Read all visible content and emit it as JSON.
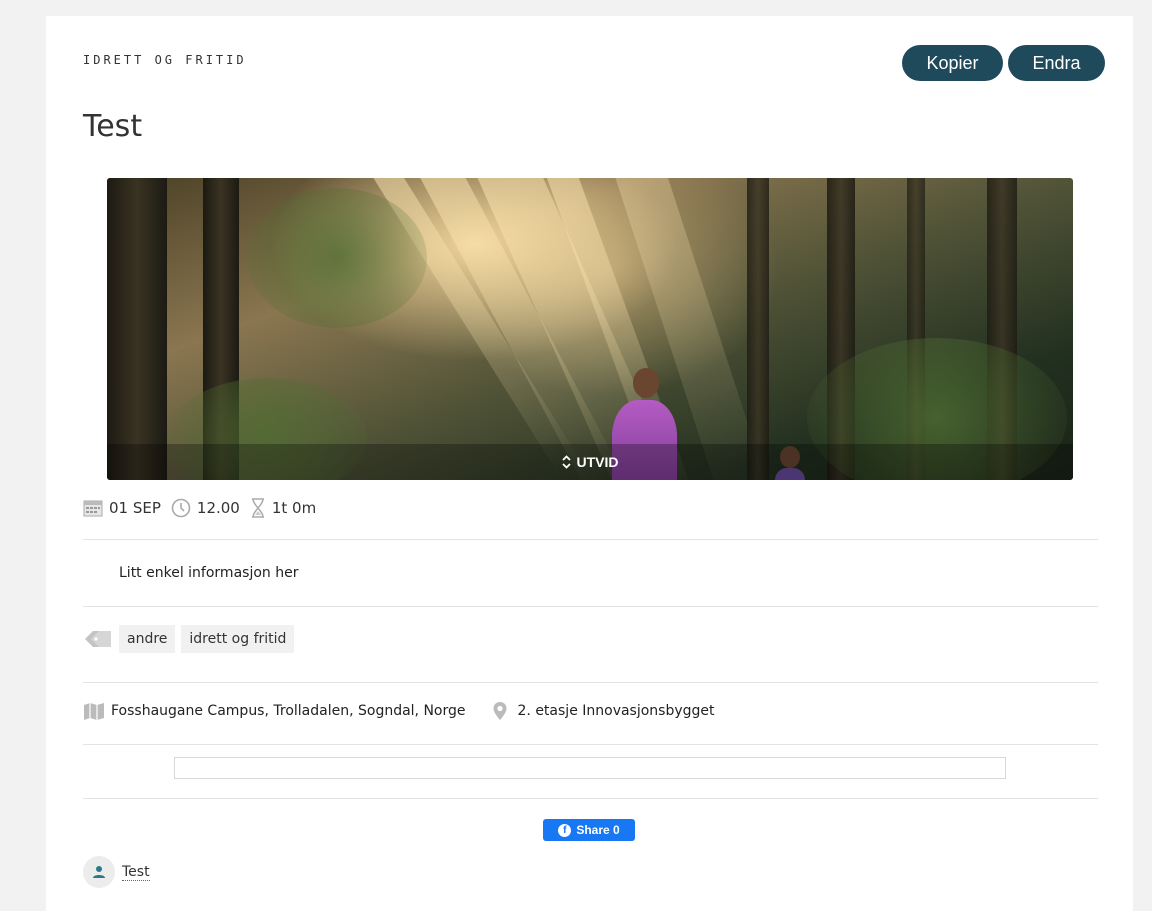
{
  "header": {
    "category": "IDRETT OG FRITID",
    "copy_label": "Kopier",
    "edit_label": "Endra",
    "title": "Test"
  },
  "hero": {
    "expand_label": "UTVID"
  },
  "meta": {
    "date": "01 SEP",
    "time": "12.00",
    "duration": "1t 0m"
  },
  "info_text": "Litt enkel informasjon her",
  "tags": [
    "andre",
    "idrett og fritid"
  ],
  "location": {
    "address": "Fosshaugane Campus, Trolladalen, Sogndal, Norge",
    "room": "2. etasje Innovasjonsbygget"
  },
  "share": {
    "label": "Share 0"
  },
  "author": {
    "name": "Test"
  },
  "colors": {
    "button_bg": "#1f4a5c",
    "facebook": "#1877f2"
  }
}
